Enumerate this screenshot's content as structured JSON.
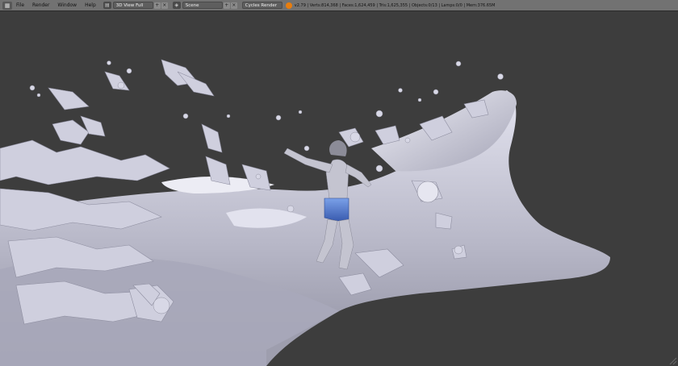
{
  "header": {
    "editor_type_icon": "view3d-icon",
    "menu": [
      "File",
      "Render",
      "Window",
      "Help"
    ],
    "screen_layout_icon": "layout-grid-icon",
    "screen_layout": "3D View Full",
    "scene_icon": "scene-icon",
    "scene": "Scene",
    "render_engine": "Cycles Render",
    "render_engine_options": [
      "Cycles Render"
    ],
    "stats": "v2.79 | Verts:814,368 | Faces:1,624,459 | Tris:1,625,355 | Objects:0/13 | Lamps:0/0 | Mem:376.65M"
  },
  "viewport": {
    "scene_content": "fluid-splash-render",
    "background_color": "#3d3d3d",
    "surface_color": "#c8c8d8"
  },
  "colors": {
    "header_bg": "#727272",
    "field_bg": "#5e5e5e",
    "accent": "#e87d0d"
  }
}
